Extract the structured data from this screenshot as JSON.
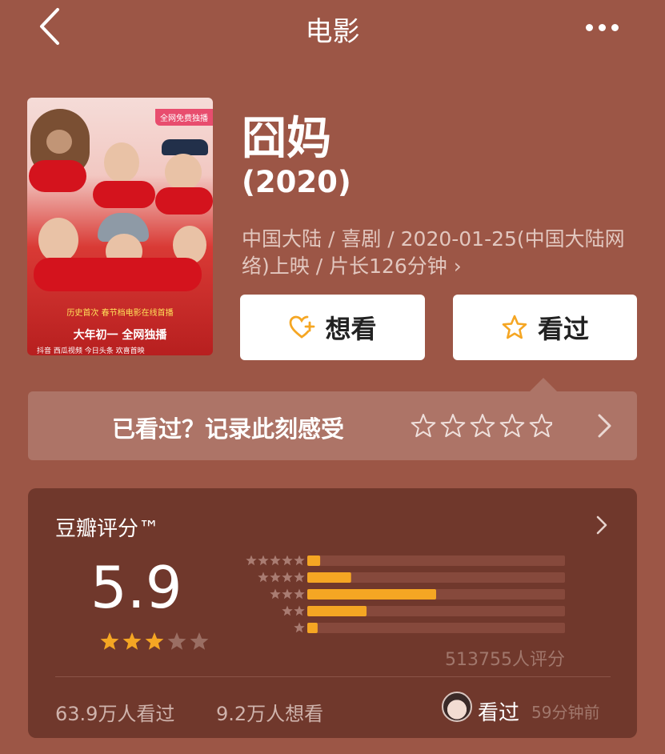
{
  "header": {
    "title": "电影",
    "back_icon": "back-arrow-icon",
    "more_icon": "more-dots-icon"
  },
  "poster": {
    "badge": "全网免费独播",
    "line1": "历史首次 春节档电影在线首播",
    "line2": "大年初一 全网独播",
    "logos": "抖音  西瓜视频  今日头条  欢喜首映"
  },
  "movie": {
    "title": "囧妈",
    "year": "(2020)",
    "meta": "中国大陆 / 喜剧 / 2020-01-25(中国大陆网络)上映 / 片长126分钟 ›"
  },
  "actions": {
    "want_label": "想看",
    "want_icon": "heart-plus-icon",
    "seen_label": "看过",
    "seen_icon": "star-outline-icon",
    "accent": "#f5a623"
  },
  "record": {
    "text": "已看过？记录此刻感受",
    "stars": 5
  },
  "rating": {
    "label": "豆瓣评分™",
    "score": "5.9",
    "score_stars": 3,
    "distribution": [
      0.05,
      0.17,
      0.5,
      0.23,
      0.04
    ],
    "count_text": "513755人评分",
    "seen_text": "63.9万人看过",
    "want_text": "9.2万人想看",
    "user_status": "看过",
    "user_time": "59分钟前",
    "bar_color": "#f5a623"
  }
}
